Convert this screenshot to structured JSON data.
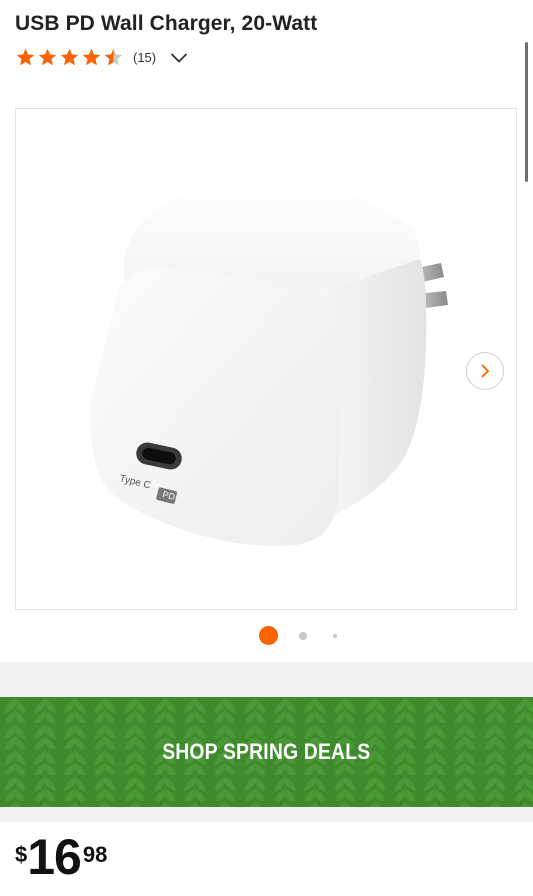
{
  "product": {
    "title": "USB PD Wall Charger, 20-Watt",
    "rating": 4.5,
    "review_count": "(15)",
    "image_port_label": "Type C",
    "image_pd_label": "PD"
  },
  "carousel": {
    "next_icon": "chevron-right-icon",
    "slide_count": 3,
    "active_index": 0
  },
  "banner": {
    "text": "SHOP SPRING DEALS"
  },
  "price": {
    "currency": "$",
    "dollars": "16",
    "cents": "98"
  },
  "colors": {
    "star": "#f96302",
    "accent": "#f96302",
    "banner": "#3e8a2c"
  }
}
